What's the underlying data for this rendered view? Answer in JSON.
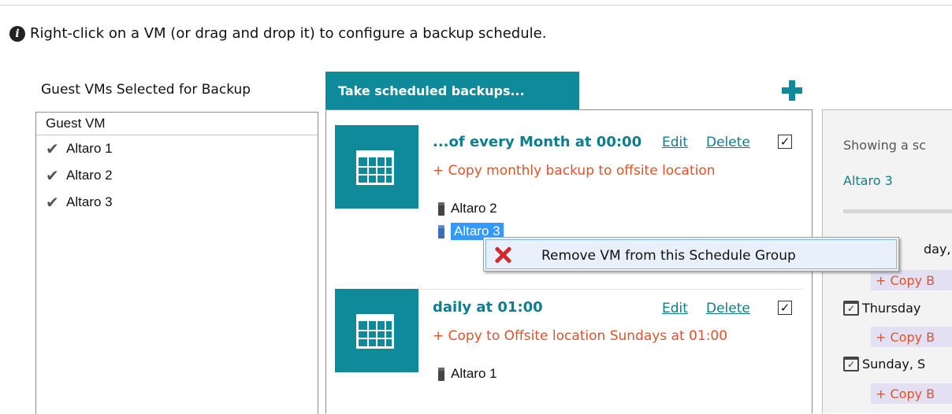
{
  "info": {
    "text": "Right-click on a VM (or drag and drop it) to configure a backup schedule."
  },
  "left_panel": {
    "title": "Guest VMs Selected for Backup",
    "column_header": "Guest VM",
    "vms": [
      {
        "label": "Altaro 1"
      },
      {
        "label": "Altaro 2"
      },
      {
        "label": "Altaro 3"
      }
    ]
  },
  "tab": {
    "label": "Take scheduled backups..."
  },
  "schedules": [
    {
      "title": "...of every Month at 00:00",
      "edit": "Edit",
      "delete": "Delete",
      "offsite": "+ Copy monthly backup to offsite location",
      "vms": [
        "Altaro 2",
        "Altaro 3"
      ]
    },
    {
      "title": "daily at 01:00",
      "edit": "Edit",
      "delete": "Delete",
      "offsite": "+ Copy to Offsite location Sundays at 01:00",
      "vms": [
        "Altaro 1"
      ]
    }
  ],
  "right_panel": {
    "showing": "Showing a sc",
    "vm": "Altaro 3",
    "row1": "day,",
    "copy1": "+ Copy B",
    "row2": "Thursday",
    "copy2": "+ Copy B",
    "row3": "Sunday, S",
    "copy3": "+ Copy B"
  },
  "context_menu": {
    "item": "Remove VM from this Schedule Group"
  },
  "colors": {
    "accent": "#0e8a9b",
    "offsite": "#e0522a",
    "selection": "#3399ff"
  }
}
